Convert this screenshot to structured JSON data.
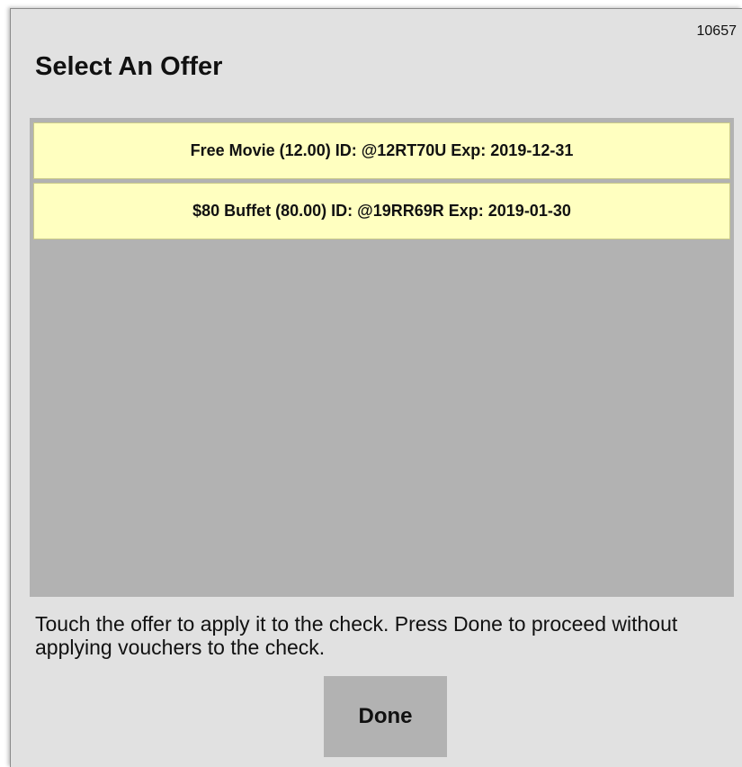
{
  "dialog": {
    "screen_id": "10657",
    "title": "Select An Offer"
  },
  "offers": [
    {
      "label": "Free Movie (12.00) ID: @12RT70U Exp: 2019-12-31"
    },
    {
      "label": "$80 Buffet (80.00) ID: @19RR69R Exp: 2019-01-30"
    }
  ],
  "instructions": "Touch the offer to apply it to the check. Press Done to proceed without applying vouchers to the check.",
  "buttons": {
    "done_label": "Done"
  },
  "colors": {
    "dialog_background": "#e1e1e1",
    "list_background": "#b2b2b2",
    "offer_background": "#ffffc0",
    "button_background": "#b2b2b2"
  }
}
